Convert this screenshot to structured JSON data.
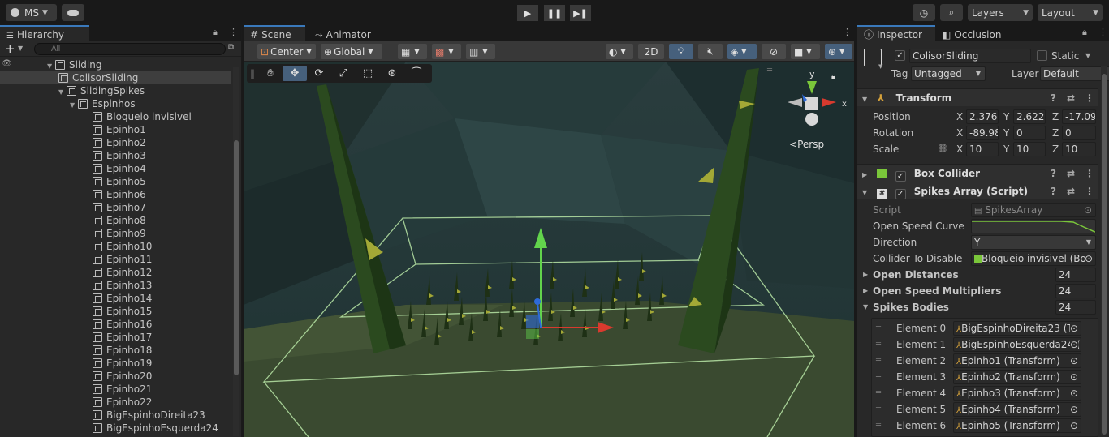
{
  "toolbar": {
    "account": "MS",
    "layers": "Layers",
    "layout": "Layout"
  },
  "hierarchy": {
    "tab": "Hierarchy",
    "search_placeholder": "All",
    "rows": [
      {
        "label": "Sliding",
        "indent": 4
      },
      {
        "label": "ColisorSliding",
        "indent": 5
      },
      {
        "label": "SlidingSpikes",
        "indent": 5
      },
      {
        "label": "Espinhos",
        "indent": 6
      },
      {
        "label": "Bloqueio invisivel",
        "indent": 7
      },
      {
        "label": "Epinho1",
        "indent": 7
      },
      {
        "label": "Epinho2",
        "indent": 7
      },
      {
        "label": "Epinho3",
        "indent": 7
      },
      {
        "label": "Epinho4",
        "indent": 7
      },
      {
        "label": "Epinho5",
        "indent": 7
      },
      {
        "label": "Epinho6",
        "indent": 7
      },
      {
        "label": "Epinho7",
        "indent": 7
      },
      {
        "label": "Epinho8",
        "indent": 7
      },
      {
        "label": "Epinho9",
        "indent": 7
      },
      {
        "label": "Epinho10",
        "indent": 7
      },
      {
        "label": "Epinho11",
        "indent": 7
      },
      {
        "label": "Epinho12",
        "indent": 7
      },
      {
        "label": "Epinho13",
        "indent": 7
      },
      {
        "label": "Epinho14",
        "indent": 7
      },
      {
        "label": "Epinho15",
        "indent": 7
      },
      {
        "label": "Epinho16",
        "indent": 7
      },
      {
        "label": "Epinho17",
        "indent": 7
      },
      {
        "label": "Epinho18",
        "indent": 7
      },
      {
        "label": "Epinho19",
        "indent": 7
      },
      {
        "label": "Epinho20",
        "indent": 7
      },
      {
        "label": "Epinho21",
        "indent": 7
      },
      {
        "label": "Epinho22",
        "indent": 7
      },
      {
        "label": "BigEspinhoDireita23",
        "indent": 7
      },
      {
        "label": "BigEspinhoEsquerda24",
        "indent": 7
      }
    ]
  },
  "scene": {
    "tabs": [
      "Scene",
      "Animator"
    ],
    "pivot": "Center",
    "space": "Global",
    "mode_2d": "2D",
    "persp": "Persp"
  },
  "inspector": {
    "tabs": [
      "Inspector",
      "Occlusion"
    ],
    "object_name": "ColisorSliding",
    "static": "Static",
    "tag_label": "Tag",
    "tag": "Untagged",
    "layer_label": "Layer",
    "layer": "Default",
    "transform": {
      "title": "Transform",
      "position_label": "Position",
      "rotation_label": "Rotation",
      "scale_label": "Scale",
      "position": {
        "x": "2.3763",
        "y": "2.6222",
        "z": "-17.09"
      },
      "rotation": {
        "x": "-89.98",
        "y": "0",
        "z": "0"
      },
      "scale": {
        "x": "10",
        "y": "10",
        "z": "10"
      }
    },
    "box_collider": "Box Collider",
    "spikes": {
      "title": "Spikes Array (Script)",
      "script_label": "Script",
      "script": "SpikesArray",
      "curve_label": "Open Speed Curve",
      "direction_label": "Direction",
      "direction": "Y",
      "collider_label": "Collider To Disable",
      "collider": "Bloqueio invisivel (Bo",
      "open_distances_label": "Open Distances",
      "open_distances": "24",
      "multipliers_label": "Open Speed Multipliers",
      "multipliers": "24",
      "bodies_label": "Spikes Bodies",
      "bodies": "24",
      "elements": [
        {
          "label": "Element 0",
          "value": "BigEspinhoDireita23 (Tr"
        },
        {
          "label": "Element 1",
          "value": "BigEspinhoEsquerda24 ("
        },
        {
          "label": "Element 2",
          "value": "Epinho1 (Transform)"
        },
        {
          "label": "Element 3",
          "value": "Epinho2 (Transform)"
        },
        {
          "label": "Element 4",
          "value": "Epinho3 (Transform)"
        },
        {
          "label": "Element 5",
          "value": "Epinho4 (Transform)"
        },
        {
          "label": "Element 6",
          "value": "Epinho5 (Transform)"
        }
      ]
    }
  },
  "colors": {
    "accent": "#3a79bb",
    "selection": "#3e3e3e",
    "panel": "#282828"
  }
}
